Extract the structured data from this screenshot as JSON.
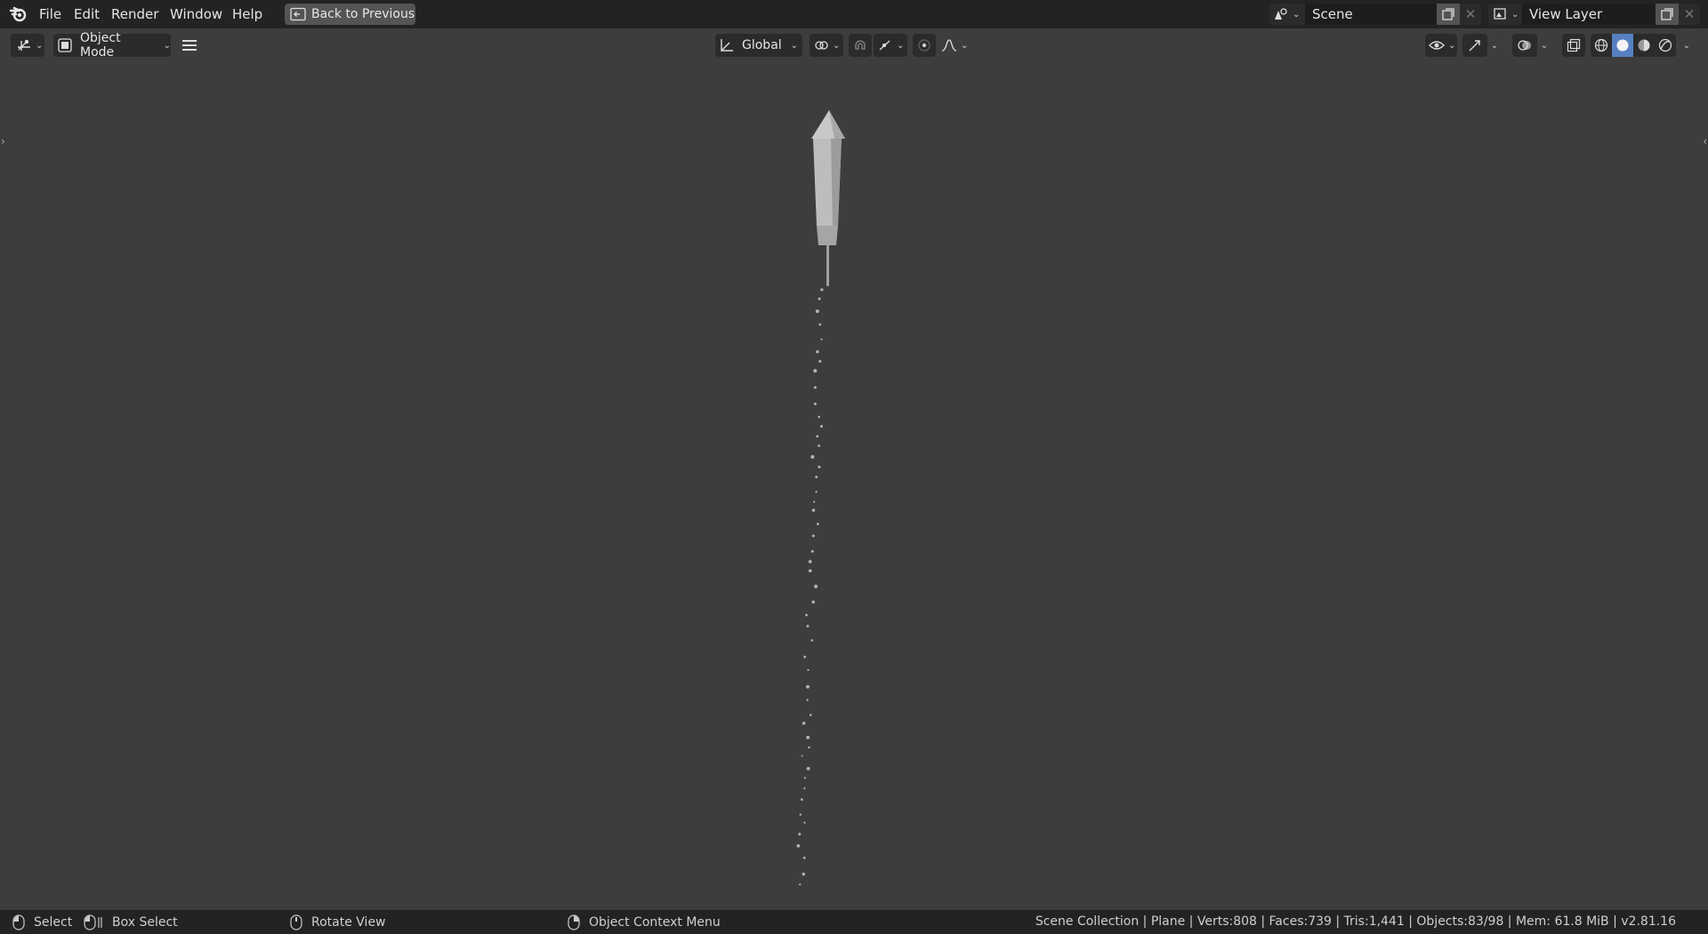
{
  "menu": {
    "file": "File",
    "edit": "Edit",
    "render": "Render",
    "window": "Window",
    "help": "Help",
    "back_to_previous": "Back to Previous"
  },
  "scene": {
    "name": "Scene"
  },
  "view_layer": {
    "name": "View Layer"
  },
  "header": {
    "mode": "Object Mode",
    "orientation": "Global"
  },
  "statusbar": {
    "select": "Select",
    "box_select": "Box Select",
    "rotate_view": "Rotate View",
    "context_menu": "Object Context Menu",
    "stats": "Scene Collection | Plane | Verts:808 | Faces:739 | Tris:1,441 | Objects:83/98 | Mem: 61.8 MiB | v2.81.16"
  },
  "colors": {
    "topbar_bg": "#232323",
    "viewport_bg": "#3d3d3d",
    "active_shading": "#5680c2"
  },
  "icons": {
    "logo": "blender-logo-icon",
    "back": "back-to-previous-icon",
    "scene": "scene-icon",
    "view_layer": "view-layer-icon"
  }
}
